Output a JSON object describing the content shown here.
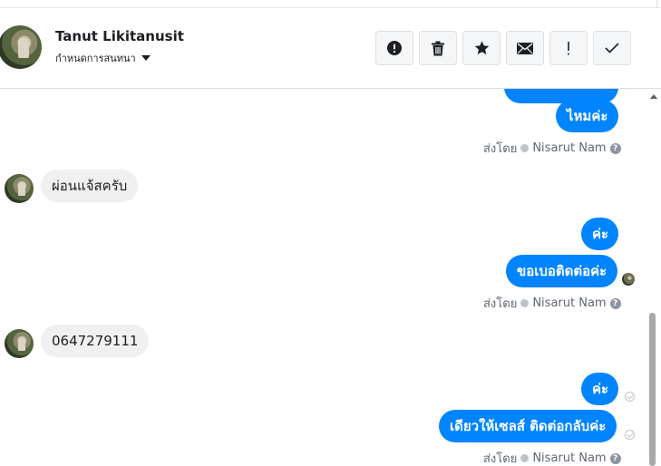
{
  "contact": {
    "name": "Tanut Likitanusit",
    "assign_label": "กำหนดการสนทนา"
  },
  "toolbar": {
    "buttons": [
      {
        "name": "spam",
        "icon": "exclamation-circle-icon"
      },
      {
        "name": "delete",
        "icon": "trash-icon"
      },
      {
        "name": "star",
        "icon": "star-icon"
      },
      {
        "name": "mark-unread",
        "icon": "envelope-icon"
      },
      {
        "name": "follow-up",
        "icon": "exclamation-icon"
      },
      {
        "name": "done",
        "icon": "check-icon"
      }
    ]
  },
  "messages": {
    "out1_partial": "",
    "out1": "ไหมค่ะ",
    "sender1": {
      "prefix": "ส่งโดย",
      "name": "Nisarut Nam"
    },
    "in1": "ผ่อนแจ้สครับ",
    "out2a": "ค่ะ",
    "out2b": "ขอเบอติดต่อค่ะ",
    "sender2": {
      "prefix": "ส่งโดย",
      "name": "Nisarut Nam"
    },
    "in2": "0647279111",
    "out3a": "ค่ะ",
    "out3b": "เดียวให้เซลส์ ติดต่อกลับค่ะ",
    "sender3": {
      "prefix": "ส่งโดย",
      "name": "Nisarut Nam"
    }
  },
  "colors": {
    "outgoing": "#0084ff",
    "incoming": "#f1f0f0",
    "border": "#dadde1"
  }
}
